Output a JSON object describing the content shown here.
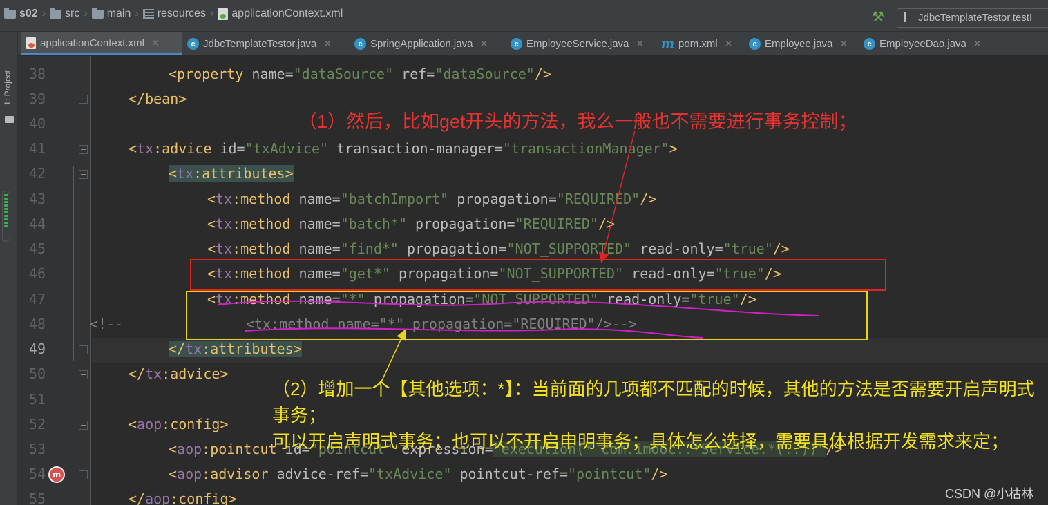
{
  "breadcrumb": {
    "items": [
      {
        "label": "s02",
        "icon": "folder-icon"
      },
      {
        "label": "src",
        "icon": "folder-icon"
      },
      {
        "label": "main",
        "icon": "folder-icon"
      },
      {
        "label": "resources",
        "icon": "resources-folder-icon"
      },
      {
        "label": "applicationContext.xml",
        "icon": "xml-file-icon"
      }
    ]
  },
  "toolbar": {
    "run_config": "JdbcTemplateTestor.testI"
  },
  "toolstrip": {
    "project_label": "1: Project",
    "bottom_label": "e"
  },
  "tabs": [
    {
      "label": "applicationContext.xml",
      "icon": "xml-file-icon",
      "active": true
    },
    {
      "label": "JdbcTemplateTestor.java",
      "icon": "class-icon",
      "active": false
    },
    {
      "label": "SpringApplication.java",
      "icon": "class-icon",
      "active": false
    },
    {
      "label": "EmployeeService.java",
      "icon": "class-icon",
      "active": false
    },
    {
      "label": "pom.xml",
      "icon": "maven-icon",
      "active": false
    },
    {
      "label": "Employee.java",
      "icon": "class-icon",
      "active": false
    },
    {
      "label": "EmployeeDao.java",
      "icon": "class-icon",
      "active": false
    }
  ],
  "editor": {
    "line_numbers": [
      "38",
      "39",
      "40",
      "41",
      "42",
      "43",
      "44",
      "45",
      "46",
      "47",
      "48",
      "49",
      "50",
      "51",
      "52",
      "53",
      "54",
      "55"
    ],
    "current_line": "49",
    "lines": {
      "l38": {
        "t1": "<",
        "t2": "property",
        "a1": " name=",
        "v1": "\"dataSource\"",
        "a2": " ref=",
        "v2": "\"dataSource\"",
        "t3": "/>"
      },
      "l39": {
        "t1": "</bean>"
      },
      "l41": {
        "t1": "<",
        "ns": "tx",
        "t2": ":advice",
        "a1": " id=",
        "v1": "\"txAdvice\"",
        "a2": " transaction-manager=",
        "v2": "\"transactionManager\"",
        "t3": ">"
      },
      "l42": {
        "t1": "<",
        "ns": "tx",
        "t2": ":attributes",
        "t3": ">"
      },
      "l43": {
        "t1": "<",
        "ns": "tx",
        "t2": ":method",
        "a1": " name=",
        "v1": "\"batchImport\"",
        "a2": " propagation=",
        "v2": "\"REQUIRED\"",
        "t3": "/>"
      },
      "l44": {
        "t1": "<",
        "ns": "tx",
        "t2": ":method",
        "a1": " name=",
        "v1": "\"batch*\"",
        "a2": " propagation=",
        "v2": "\"REQUIRED\"",
        "t3": "/>"
      },
      "l45": {
        "t1": "<",
        "ns": "tx",
        "t2": ":method",
        "a1": " name=",
        "v1": "\"find*\"",
        "a2": " propagation=",
        "v2": "\"NOT_SUPPORTED\"",
        "a3": " read-only=",
        "v3": "\"true\"",
        "t3": "/>"
      },
      "l46": {
        "t1": "<",
        "ns": "tx",
        "t2": ":method",
        "a1": " name=",
        "v1": "\"get*\"",
        "a2": " propagation=",
        "v2": "\"NOT_SUPPORTED\"",
        "a3": " read-only=",
        "v3": "\"true\"",
        "t3": "/>"
      },
      "l47": {
        "t1": "<",
        "ns": "tx",
        "t2": ":method",
        "a1": " name=",
        "v1": "\"*\"",
        "a2": " propagation=",
        "v2": "\"NOT_SUPPORTED\"",
        "a3": " read-only=",
        "v3": "\"true\"",
        "t3": "/>"
      },
      "l48": {
        "c1": "<!--",
        "c2": "<tx:method name=\"*\" propagation=\"REQUIRED\"/>-->"
      },
      "l49": {
        "t1": "</",
        "ns": "tx",
        "t2": ":attributes",
        "t3": ">"
      },
      "l50": {
        "t1": "</",
        "ns": "tx",
        "t2": ":advice",
        "t3": ">"
      },
      "l52": {
        "t1": "<",
        "ns": "aop",
        "t2": ":config",
        "t3": ">"
      },
      "l53": {
        "t1": "<",
        "ns": "aop",
        "t2": ":pointcut",
        "a1": " id=",
        "v1": "\"pointcut\"",
        "a2": " expression=",
        "v2": "\"execution(* com.imooc..*Service.*(..))\"",
        "t3": "/>"
      },
      "l54": {
        "t1": "<",
        "ns": "aop",
        "t2": ":advisor",
        "a1": " advice-ref=",
        "v1": "\"txAdvice\"",
        "a2": " pointcut-ref=",
        "v2": "\"pointcut\"",
        "t3": "/>"
      },
      "l55": {
        "t1": "</",
        "ns": "aop",
        "t2": ":config",
        "t3": ">"
      }
    }
  },
  "annotations": {
    "note1": "（1）然后，比如get开头的方法，我么一般也不需要进行事务控制；",
    "note2_line1": "（2）增加一个【其他选项：*】：当前面的几项都不匹配的时候，其他的方法是否需要开启声明式事务；",
    "note2_line2": "可以开启声明式事务；也可以不开启申明事务；具体怎么选择，需要具体根据开发需求来定；",
    "colors": {
      "red": "#e02424",
      "yellow": "#e8d21c",
      "magenta": "#d020c8"
    }
  },
  "watermark": "CSDN @小枯林"
}
